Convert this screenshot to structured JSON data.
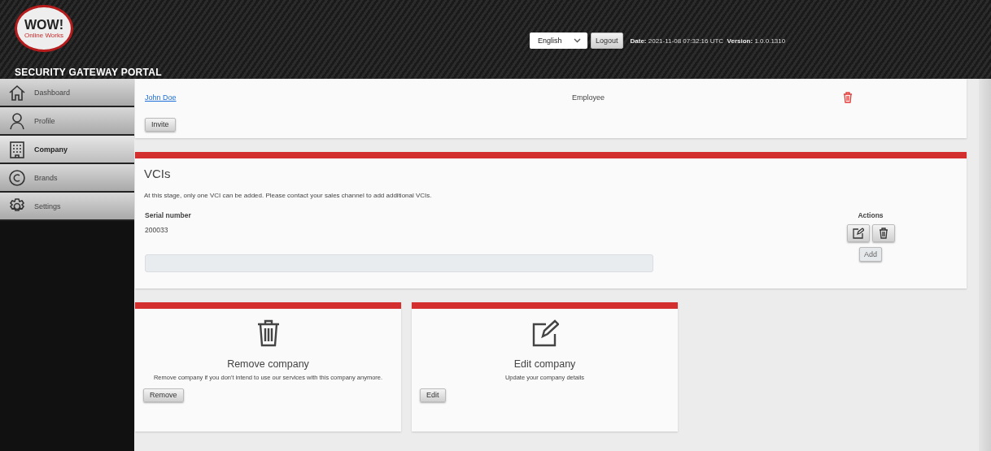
{
  "header": {
    "logo_text": "WOW!",
    "logo_subtext": "Online Works",
    "portal_title": "SECURITY GATEWAY PORTAL",
    "language": "English",
    "logout": "Logout",
    "date_label": "Date:",
    "date": "2021-11-08 07:32:16 UTC",
    "version_label": "Version:",
    "version": "1.0.0.1310"
  },
  "sidebar": {
    "items": [
      {
        "label": "Dashboard",
        "selected": false
      },
      {
        "label": "Profile",
        "selected": false
      },
      {
        "label": "Company",
        "selected": true
      },
      {
        "label": "Brands",
        "selected": false
      },
      {
        "label": "Settings",
        "selected": false
      }
    ]
  },
  "members": {
    "rows": [
      {
        "name": "John Doe",
        "role": "Employee",
        "removable": true
      }
    ],
    "invite": "Invite"
  },
  "vcis": {
    "title": "VCIs",
    "note": "At this stage, only one VCI can be added. Please contact your sales channel to add additional VCIs.",
    "columns": [
      "Serial number",
      "Actions"
    ],
    "rows": [
      {
        "serial": "200033"
      }
    ],
    "add": "Add"
  },
  "actions": [
    {
      "kind": "remove",
      "title": "Remove company",
      "text": "Remove company if you don't intend to use our services with this company anymore.",
      "button": "Remove"
    },
    {
      "kind": "edit",
      "title": "Edit company",
      "text": "Update your company details",
      "button": "Edit"
    }
  ]
}
